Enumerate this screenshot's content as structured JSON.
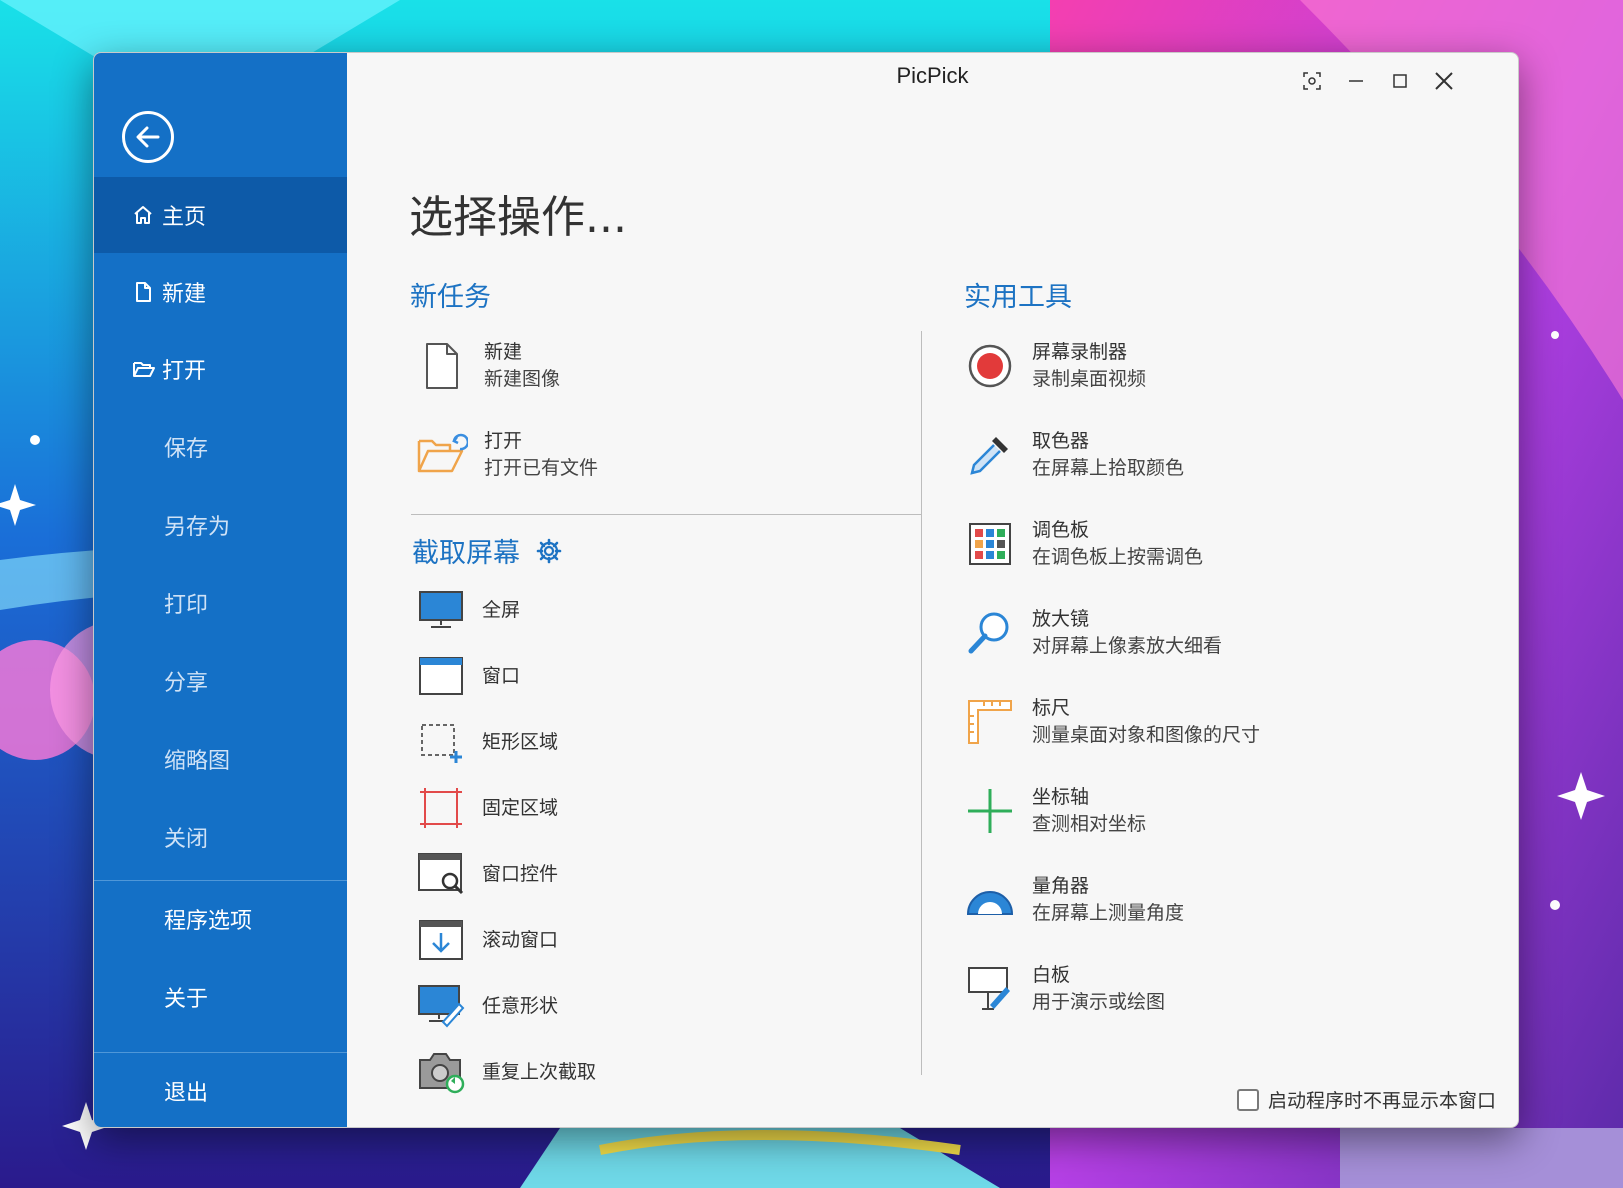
{
  "window": {
    "title": "PicPick"
  },
  "sidebar": {
    "items": [
      {
        "label": "主页",
        "icon": "home-icon",
        "active": true
      },
      {
        "label": "新建",
        "icon": "file-icon"
      },
      {
        "label": "打开",
        "icon": "folder-open-icon"
      },
      {
        "label": "保存"
      },
      {
        "label": "另存为"
      },
      {
        "label": "打印"
      },
      {
        "label": "分享"
      },
      {
        "label": "缩略图"
      },
      {
        "label": "关闭"
      },
      {
        "label": "程序选项"
      },
      {
        "label": "关于"
      },
      {
        "label": "退出"
      }
    ]
  },
  "main": {
    "heading": "选择操作...",
    "new_task": {
      "title": "新任务",
      "items": [
        {
          "title": "新建",
          "subtitle": "新建图像",
          "icon": "new-file-icon"
        },
        {
          "title": "打开",
          "subtitle": "打开已有文件",
          "icon": "open-folder-icon"
        }
      ]
    },
    "capture": {
      "title": "截取屏幕",
      "settings_icon": "gear-icon",
      "items": [
        {
          "label": "全屏",
          "icon": "monitor-icon"
        },
        {
          "label": "窗口",
          "icon": "window-icon"
        },
        {
          "label": "矩形区域",
          "icon": "rectangle-select-icon"
        },
        {
          "label": "固定区域",
          "icon": "fixed-region-icon"
        },
        {
          "label": "窗口控件",
          "icon": "window-control-icon"
        },
        {
          "label": "滚动窗口",
          "icon": "scroll-window-icon"
        },
        {
          "label": "任意形状",
          "icon": "freehand-icon"
        },
        {
          "label": "重复上次截取",
          "icon": "repeat-capture-icon"
        }
      ]
    },
    "tools": {
      "title": "实用工具",
      "items": [
        {
          "title": "屏幕录制器",
          "subtitle": "录制桌面视频",
          "icon": "record-icon"
        },
        {
          "title": "取色器",
          "subtitle": "在屏幕上拾取颜色",
          "icon": "eyedropper-icon"
        },
        {
          "title": "调色板",
          "subtitle": "在调色板上按需调色",
          "icon": "palette-icon"
        },
        {
          "title": "放大镜",
          "subtitle": "对屏幕上像素放大细看",
          "icon": "magnifier-icon"
        },
        {
          "title": "标尺",
          "subtitle": "测量桌面对象和图像的尺寸",
          "icon": "ruler-icon"
        },
        {
          "title": "坐标轴",
          "subtitle": "查测相对坐标",
          "icon": "crosshair-icon"
        },
        {
          "title": "量角器",
          "subtitle": "在屏幕上测量角度",
          "icon": "protractor-icon"
        },
        {
          "title": "白板",
          "subtitle": "用于演示或绘图",
          "icon": "whiteboard-icon"
        }
      ]
    },
    "footer": {
      "checkbox_label": "启动程序时不再显示本窗口",
      "checked": false
    }
  },
  "colors": {
    "sidebar": "#1470c6",
    "sidebar_active": "#0d5aa8",
    "accent": "#1d73c3",
    "content_bg": "#f7f7f7"
  }
}
